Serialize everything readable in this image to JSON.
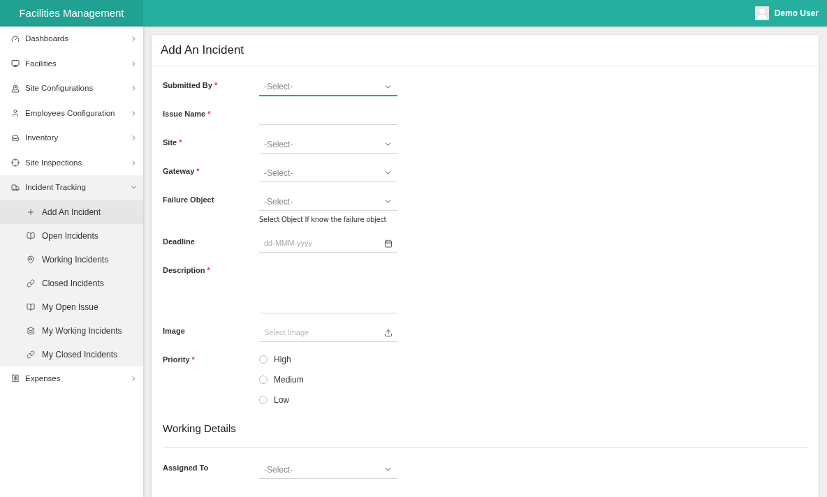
{
  "header": {
    "app_title": "Facilities Management",
    "user_name": "Demo User"
  },
  "sidebar": {
    "items": [
      {
        "label": "Dashboards",
        "expanded": false
      },
      {
        "label": "Facilities",
        "expanded": false
      },
      {
        "label": "Site Configurations",
        "expanded": false
      },
      {
        "label": "Employees Configuration",
        "expanded": false
      },
      {
        "label": "Inventory",
        "expanded": false
      },
      {
        "label": "Site Inspections",
        "expanded": false
      },
      {
        "label": "Incident Tracking",
        "expanded": true,
        "children": [
          {
            "label": "Add An Incident",
            "selected": true
          },
          {
            "label": "Open Incidents",
            "selected": false
          },
          {
            "label": "Working Incidents",
            "selected": false
          },
          {
            "label": "Closed Incidents",
            "selected": false
          },
          {
            "label": "My Open Issue",
            "selected": false
          },
          {
            "label": "My Working Incidents",
            "selected": false
          },
          {
            "label": "My Closed Incidents",
            "selected": false
          }
        ]
      },
      {
        "label": "Expenses",
        "expanded": false
      }
    ]
  },
  "form": {
    "title": "Add An Incident",
    "fields": [
      {
        "kind": "select",
        "label": "Submitted By",
        "required_mark": "*",
        "placeholder": "-Select-",
        "focused": true
      },
      {
        "kind": "text",
        "label": "Issue Name",
        "required_mark": "*",
        "focused": false
      },
      {
        "kind": "select",
        "label": "Site",
        "required_mark": "*",
        "placeholder": "-Select-",
        "focused": false
      },
      {
        "kind": "select",
        "label": "Gateway",
        "required_mark": "*",
        "placeholder": "-Select-",
        "focused": false
      },
      {
        "kind": "select",
        "label": "Failure Object",
        "placeholder": "-Select-",
        "focused": false,
        "hint": "Select Object If know the failure object"
      },
      {
        "kind": "date",
        "label": "Deadline",
        "placeholder": "dd-MMM-yyyy",
        "focused": false
      },
      {
        "kind": "textarea",
        "label": "Description",
        "required_mark": "*",
        "focused": false
      },
      {
        "kind": "file",
        "label": "Image",
        "placeholder": "Select Image",
        "focused": false
      },
      {
        "kind": "radio",
        "label": "Priority",
        "required_mark": "*",
        "options": [
          {
            "label": "High",
            "selected": false
          },
          {
            "label": "Medium",
            "selected": false
          },
          {
            "label": "Low",
            "selected": false
          }
        ]
      }
    ],
    "section_title": "Working Details",
    "section_fields": [
      {
        "kind": "select",
        "label": "Assigned To",
        "placeholder": "-Select-",
        "focused": false
      }
    ]
  }
}
